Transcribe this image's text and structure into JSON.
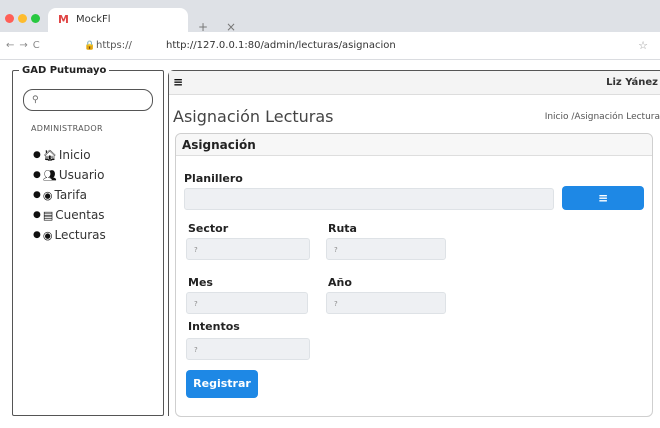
{
  "browser": {
    "tab_title": "MockFl",
    "tab_plus": "+",
    "tab_close": "×",
    "url_short": "https://",
    "url_full": "http://127.0.0.1:80/admin/lecturas/asignacion"
  },
  "sidebar": {
    "title": "GAD Putumayo",
    "search_placeholder": "",
    "section_label": "ADMINISTRADOR",
    "items": [
      {
        "label": "Inicio",
        "icon": "home-icon"
      },
      {
        "label": "Usuario",
        "icon": "users-icon"
      },
      {
        "label": "Tarifa",
        "icon": "binoculars-icon"
      },
      {
        "label": "Cuentas",
        "icon": "book-icon"
      },
      {
        "label": "Lecturas",
        "icon": "binoculars-icon"
      }
    ]
  },
  "header": {
    "user_name": "Liz Yánez"
  },
  "page": {
    "title": "Asignación Lecturas",
    "breadcrumb": "Inicio /Asignación Lectura"
  },
  "form": {
    "card_title": "Asignación",
    "planillero_label": "Planillero",
    "sector_label": "Sector",
    "sector_value": "?",
    "ruta_label": "Ruta",
    "ruta_value": "?",
    "mes_label": "Mes",
    "mes_value": "?",
    "anio_label": "Año",
    "anio_value": "?",
    "intentos_label": "Intentos",
    "intentos_value": "?",
    "submit_label": "Registrar"
  },
  "colors": {
    "accent": "#1e88e5",
    "input_bg": "#eef0f3"
  }
}
